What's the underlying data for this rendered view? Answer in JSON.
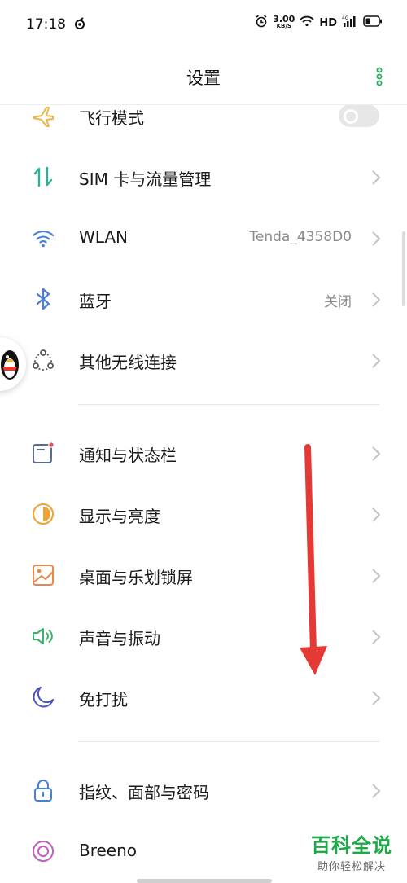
{
  "status": {
    "time": "17:18",
    "speed_value": "3.00",
    "speed_unit": "KB/S",
    "hd": "HD",
    "network": "4G"
  },
  "header": {
    "title": "设置"
  },
  "items": [
    {
      "label": "飞行模式",
      "type": "toggle",
      "on": false,
      "icon": "airplane-icon",
      "color": "#E8B84A"
    },
    {
      "label": "SIM 卡与流量管理",
      "icon": "sim-data-icon",
      "color": "#2BB29A"
    },
    {
      "label": "WLAN",
      "value": "Tenda_4358D0",
      "icon": "wifi-icon",
      "color": "#4A7FD6"
    },
    {
      "label": "蓝牙",
      "value": "关闭",
      "icon": "bluetooth-icon",
      "color": "#4A7FD6"
    },
    {
      "label": "其他无线连接",
      "icon": "wireless-connect-icon",
      "color": "#555555"
    },
    {
      "label": "通知与状态栏",
      "icon": "notification-icon",
      "color": "#5A6C8C"
    },
    {
      "label": "显示与亮度",
      "icon": "display-brightness-icon",
      "color": "#F0A234"
    },
    {
      "label": "桌面与乐划锁屏",
      "icon": "wallpaper-icon",
      "color": "#E8884A"
    },
    {
      "label": "声音与振动",
      "icon": "sound-icon",
      "color": "#3DB16E"
    },
    {
      "label": "免打扰",
      "icon": "moon-icon",
      "color": "#4B52B8"
    },
    {
      "label": "指纹、面部与密码",
      "icon": "lock-icon",
      "color": "#4A7FD6"
    },
    {
      "label": "Breeno",
      "icon": "breeno-icon",
      "color": "#C25BC2"
    }
  ],
  "watermark": {
    "title": "百科全说",
    "subtitle": "助你轻松解决"
  },
  "colors": {
    "arrow": "#E53935",
    "watermark": "#1FAA4A"
  }
}
